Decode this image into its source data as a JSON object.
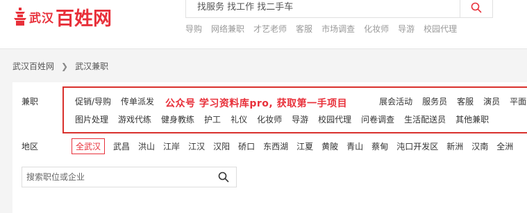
{
  "header": {
    "logo_city": "武汉",
    "logo_brand": "百姓网",
    "search_placeholder": "找服务 找工作 找二手车",
    "hotlinks": [
      "导购",
      "网络兼职",
      "才艺老师",
      "客服",
      "市场调查",
      "化妆师",
      "导游",
      "校园代理"
    ]
  },
  "breadcrumb": {
    "home": "武汉百姓网",
    "current": "武汉兼职"
  },
  "filters": {
    "category_label": "兼职",
    "categories_row1": [
      "促销/导购",
      "传单派发",
      "",
      "",
      "",
      "",
      "",
      "展会活动",
      "服务员",
      "客服",
      "演员",
      "平面设"
    ],
    "categories_row2": [
      "图片处理",
      "游戏代练",
      "健身教练",
      "护工",
      "礼仪",
      "化妆师",
      "导游",
      "校园代理",
      "问卷调查",
      "生活配送员",
      "其他兼职"
    ],
    "overlay_text": "公众号 学习资料库pro, 获取第一手项目",
    "area_label": "地区",
    "areas": [
      "全武汉",
      "武昌",
      "洪山",
      "江岸",
      "江汉",
      "汉阳",
      "硚口",
      "东西湖",
      "江夏",
      "黄陂",
      "青山",
      "蔡甸",
      "沌口开发区",
      "新洲",
      "汉南",
      "全洲"
    ],
    "job_search_placeholder": "搜索职位或企业"
  },
  "colors": {
    "brand_red": "#e8303a",
    "highlight_box": "#d9302c"
  }
}
